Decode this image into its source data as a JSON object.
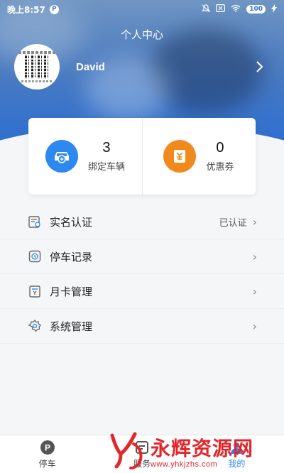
{
  "status_bar": {
    "time": "晚上8:57",
    "battery": "100"
  },
  "header": {
    "title": "个人中心",
    "username": "David"
  },
  "stats": [
    {
      "value": "3",
      "label": "绑定车辆",
      "icon": "car-link-icon",
      "color": "#2d88f0"
    },
    {
      "value": "0",
      "label": "优惠券",
      "icon": "coupon-icon",
      "color": "#f08a1d"
    }
  ],
  "menu": [
    {
      "label": "实名认证",
      "value": "已认证",
      "icon": "id-card-icon"
    },
    {
      "label": "停车记录",
      "value": "",
      "icon": "parking-record-icon"
    },
    {
      "label": "月卡管理",
      "value": "",
      "icon": "month-card-icon"
    },
    {
      "label": "系统管理",
      "value": "",
      "icon": "settings-icon"
    }
  ],
  "tabbar": [
    {
      "label": "停车",
      "icon": "parking-icon"
    },
    {
      "label": "服务",
      "icon": "service-icon"
    },
    {
      "label": "我的",
      "icon": "profile-icon"
    }
  ],
  "watermark": {
    "title": "永辉资源网",
    "url": "www.yhkjzhs.com"
  },
  "colors": {
    "accent": "#2d88f0",
    "header": "#4d7cc0",
    "coupon": "#f08a1d",
    "watermark": "#e3262a"
  }
}
